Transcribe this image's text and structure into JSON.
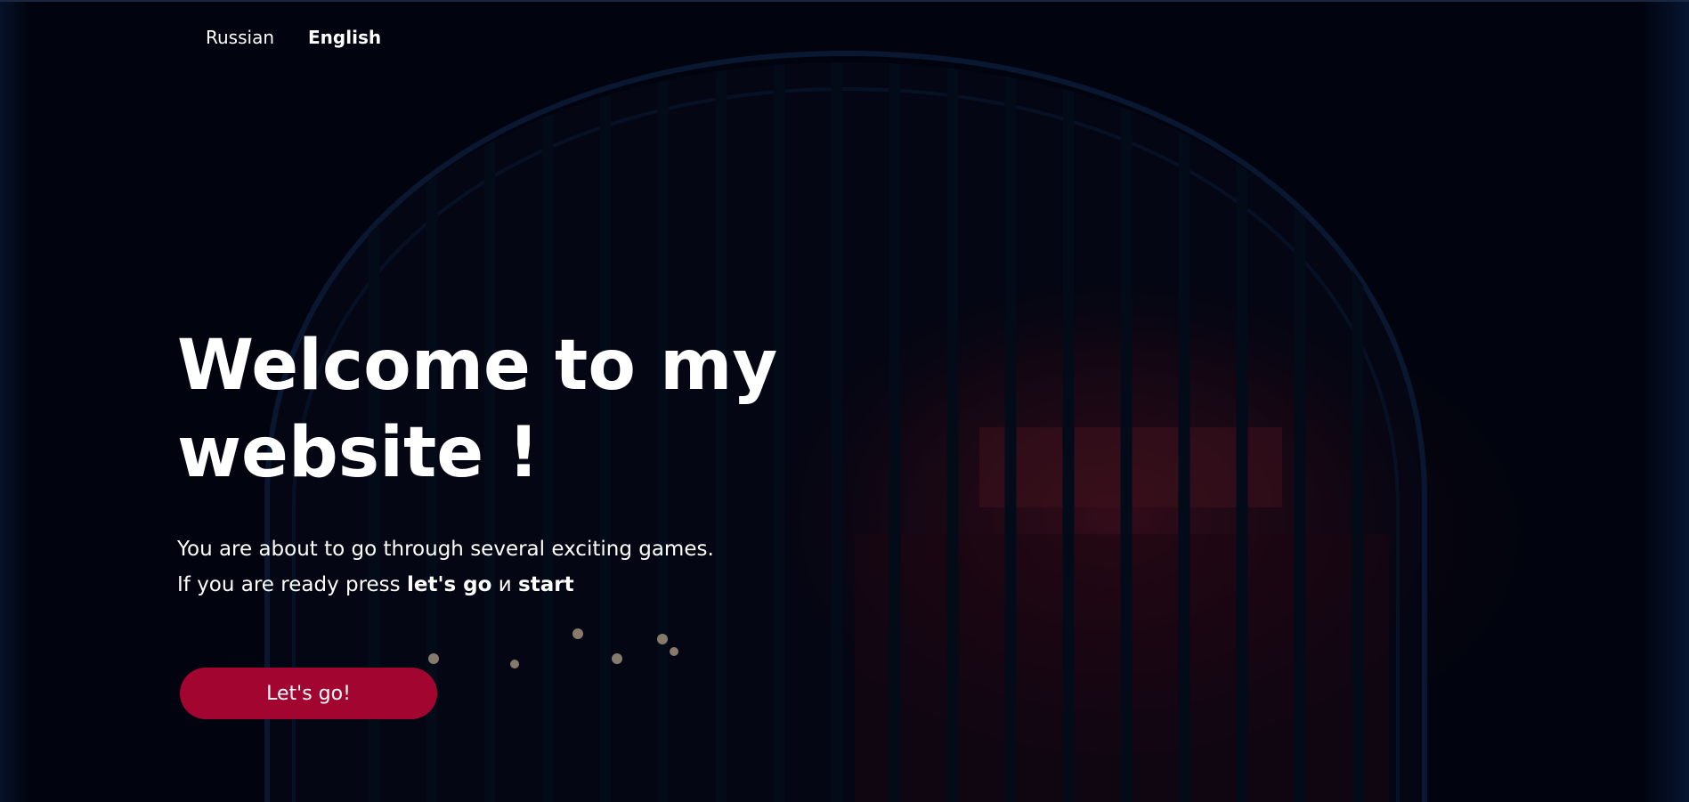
{
  "nav": {
    "languages": [
      {
        "label": "Russian",
        "active": false
      },
      {
        "label": "English",
        "active": true
      }
    ]
  },
  "hero": {
    "title_line1": "Welcome to my",
    "title_line2": "website !",
    "line1": "You are about to go through several exciting games.",
    "line2_prefix": "If you are ready press ",
    "line2_bold1": "let's go",
    "line2_middle": " и ",
    "line2_bold2": "start",
    "cta_label": "Let's go!"
  },
  "colors": {
    "accent": "#a2052f",
    "background": "#020612",
    "text": "#ffffff"
  }
}
